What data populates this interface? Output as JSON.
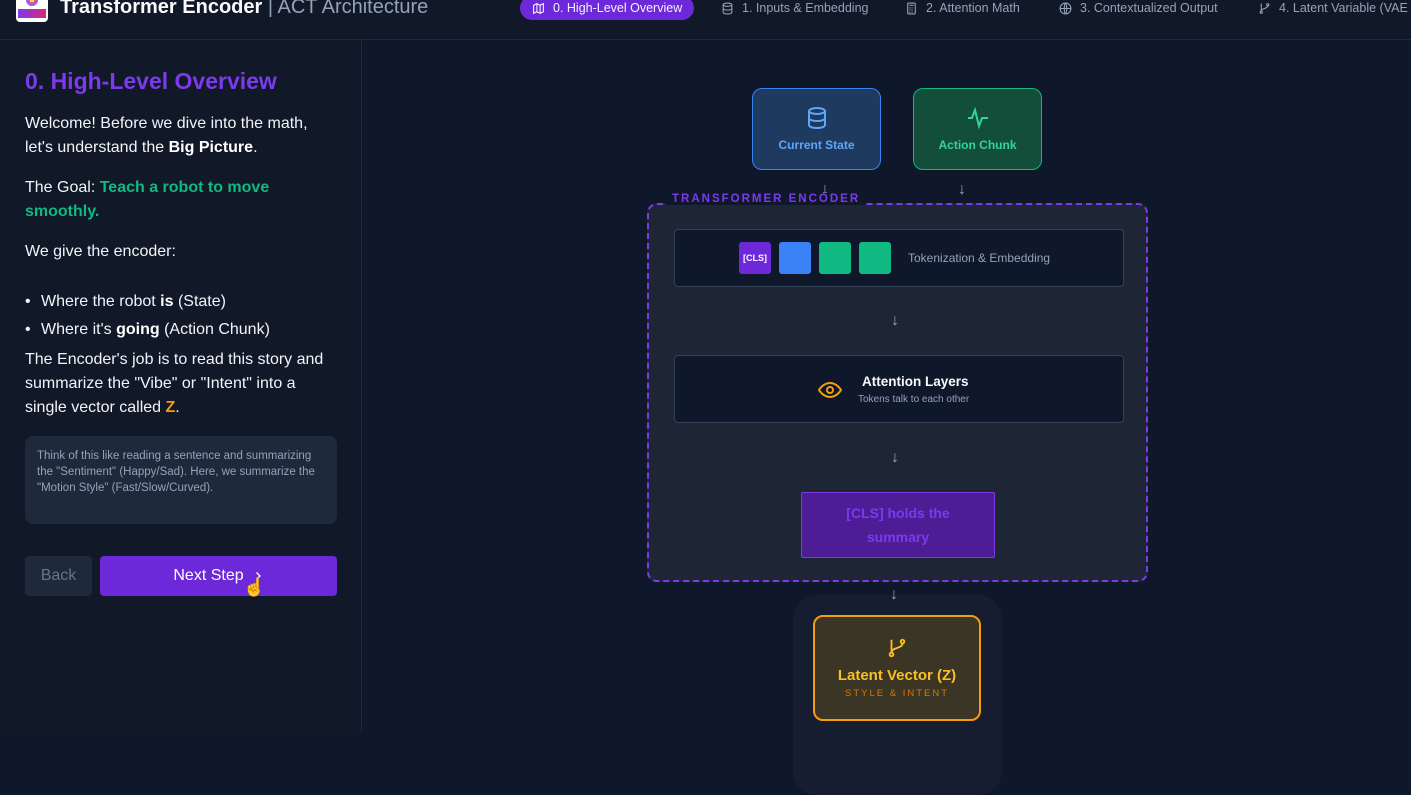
{
  "header": {
    "title": "Transformer Encoder",
    "subtitle": "| ACT Architecture",
    "tabs": [
      {
        "label": "0. High-Level Overview",
        "icon": "map-icon",
        "active": true
      },
      {
        "label": "1. Inputs & Embedding",
        "icon": "database-icon",
        "active": false
      },
      {
        "label": "2. Attention Math",
        "icon": "calculator-icon",
        "active": false
      },
      {
        "label": "3. Contextualized Output",
        "icon": "globe-icon",
        "active": false
      },
      {
        "label": "4. Latent Variable (VAE",
        "icon": "git-branch-icon",
        "active": false
      }
    ]
  },
  "sidebar": {
    "step_title": "0. High-Level Overview",
    "welcome_pre": "Welcome! Before we dive into the math, let's understand the ",
    "welcome_bold": "Big Picture",
    "welcome_post": ".",
    "goal_label": "The Goal: ",
    "goal_text": "Teach a robot to move smoothly.",
    "give_text": "We give the encoder:",
    "bullet1_pre": "Where the robot ",
    "bullet1_bold": "is",
    "bullet1_post": " (State)",
    "bullet2_pre": "Where it's ",
    "bullet2_bold": "going",
    "bullet2_post": " (Action Chunk)",
    "job_pre": "The Encoder's job is to read this story and summarize the \"Vibe\" or \"Intent\" into a single vector called ",
    "job_z": "Z",
    "job_post": ".",
    "note": "Think of this like reading a sentence and summarizing the \"Sentiment\" (Happy/Sad). Here, we summarize the \"Motion Style\" (Fast/Slow/Curved).",
    "back_label": "Back",
    "next_label": "Next Step"
  },
  "diagram": {
    "state_label": "Current State",
    "action_label": "Action Chunk",
    "encoder_label": "TRANSFORMER ENCODER",
    "cls_token": "[CLS]",
    "tokenization_label": "Tokenization & Embedding",
    "attention_title": "Attention Layers",
    "attention_sub": "Tokens talk to each other",
    "cls_summary": "[CLS] holds the summary",
    "latent_title": "Latent Vector (Z)",
    "latent_sub": "STYLE & INTENT"
  },
  "colors": {
    "accent": "#6d28d9",
    "state": "#3b82f6",
    "action": "#10b981",
    "latent": "#f59e0b"
  }
}
